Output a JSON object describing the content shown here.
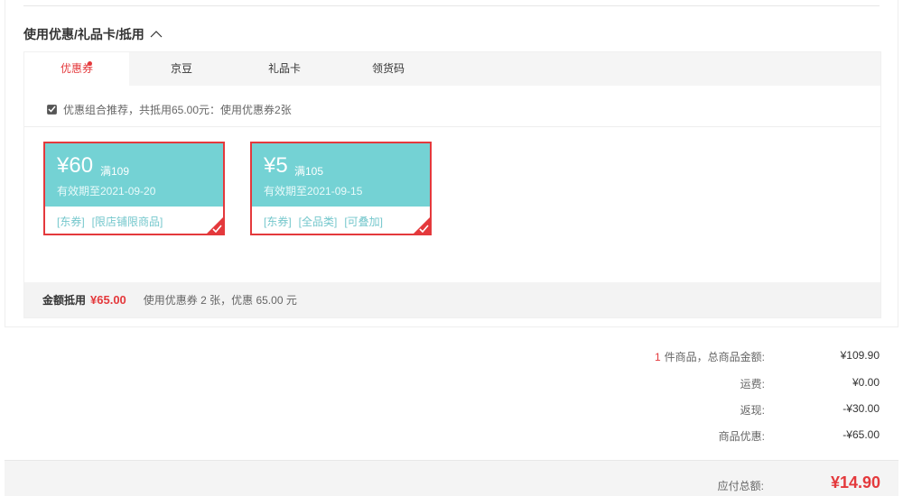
{
  "section": {
    "title": "使用优惠/礼品卡/抵用"
  },
  "tabs": [
    {
      "label": "优惠券",
      "active": true,
      "has_dot": true
    },
    {
      "label": "京豆",
      "active": false
    },
    {
      "label": "礼品卡",
      "active": false
    },
    {
      "label": "领货码",
      "active": false
    }
  ],
  "recommend": {
    "checked": true,
    "text": "优惠组合推荐，共抵用65.00元：使用优惠券2张"
  },
  "coupons": [
    {
      "amount": "¥60",
      "condition": "满109",
      "validity": "有效期至2021-09-20",
      "tags": [
        "[东券]",
        "[限店铺限商品]"
      ],
      "selected": true
    },
    {
      "amount": "¥5",
      "condition": "满105",
      "validity": "有效期至2021-09-15",
      "tags": [
        "[东券]",
        "[全品类]",
        "[可叠加]"
      ],
      "selected": true
    }
  ],
  "summary": {
    "label": "金额抵用",
    "amount": "¥65.00",
    "detail": "使用优惠券 2 张，优惠 65.00 元"
  },
  "totals": {
    "items_count": "1",
    "items_label": "件商品，总商品金额:",
    "items_value": "¥109.90",
    "shipping_label": "运费:",
    "shipping_value": "¥0.00",
    "cashback_label": "返现:",
    "cashback_value": "-¥30.00",
    "discount_label": "商品优惠:",
    "discount_value": "-¥65.00"
  },
  "payable": {
    "label": "应付总额:",
    "amount": "¥14.90"
  },
  "colors": {
    "accent_red": "#e4393c",
    "coupon_teal": "#74d2d4"
  }
}
